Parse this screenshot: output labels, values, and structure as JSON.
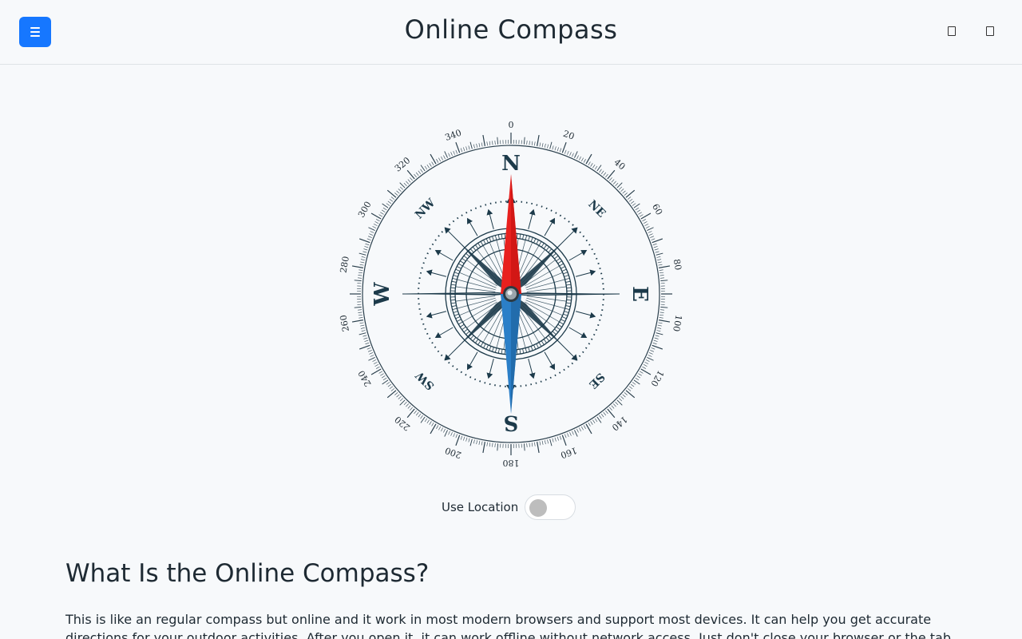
{
  "header": {
    "title": "Online Compass",
    "menu_icon": "hamburger-icon",
    "right_icons": [
      "fullscreen-icon",
      "theme-icon"
    ]
  },
  "compass": {
    "degree_labels": [
      "0",
      "20",
      "40",
      "60",
      "80",
      "100",
      "120",
      "140",
      "160",
      "180",
      "200",
      "220",
      "240",
      "260",
      "280",
      "300",
      "320",
      "340"
    ],
    "cardinals": {
      "n": "N",
      "e": "E",
      "s": "S",
      "w": "W"
    },
    "intercardinals": {
      "ne": "NE",
      "se": "SE",
      "sw": "SW",
      "nw": "NW"
    },
    "heading_degrees": 0,
    "needle_north_color": "#e8201e",
    "needle_south_color": "#2b7fc8",
    "rose_color": "#1c3a4a"
  },
  "location": {
    "label": "Use Location",
    "enabled": false
  },
  "content": {
    "heading": "What Is the Online Compass?",
    "paragraph": "This is like an regular compass but online and it work in most modern browsers and support most devices. It can help you get accurate directions for your outdoor activities. After you open it, it can work offline without network access. Just don't close your browser or the tab."
  },
  "colors": {
    "accent": "#1677ff",
    "background": "#f7f9fb"
  }
}
